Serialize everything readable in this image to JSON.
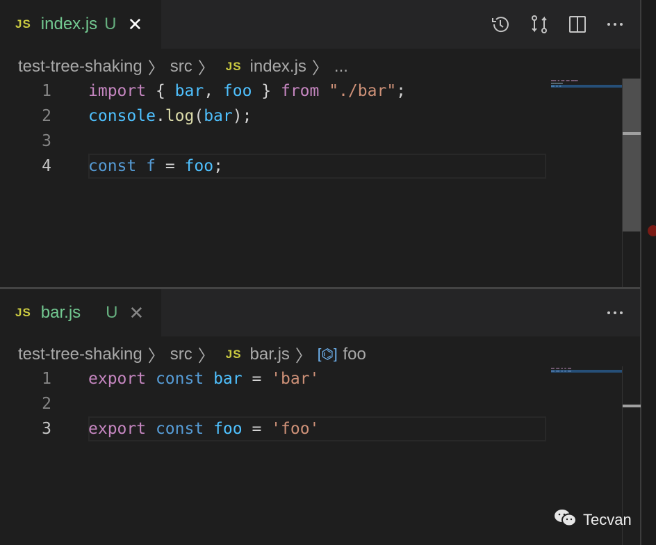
{
  "top_editor": {
    "tab": {
      "icon": "JS",
      "filename": "index.js",
      "status": "U"
    },
    "actions": [
      "timeline-icon",
      "compare-changes-icon",
      "split-editor-icon",
      "more-actions-icon"
    ],
    "breadcrumb": {
      "project": "test-tree-shaking",
      "folder": "src",
      "icon": "JS",
      "file": "index.js",
      "symbol": "..."
    },
    "lines": [
      {
        "n": "1"
      },
      {
        "n": "2"
      },
      {
        "n": "3"
      },
      {
        "n": "4"
      }
    ],
    "tokens": {
      "l1": [
        "import",
        " { ",
        "bar",
        ", ",
        "foo",
        " } ",
        "from",
        " ",
        "\"./bar\"",
        ";"
      ],
      "l2": [
        "console",
        ".",
        "log",
        "(",
        "bar",
        ");"
      ],
      "l4": [
        "const",
        " ",
        "f",
        " = ",
        "foo",
        ";"
      ]
    }
  },
  "bottom_editor": {
    "tab": {
      "icon": "JS",
      "filename": "bar.js",
      "status": "U"
    },
    "breadcrumb": {
      "project": "test-tree-shaking",
      "folder": "src",
      "icon": "JS",
      "file": "bar.js",
      "symbol": "foo"
    },
    "lines": [
      {
        "n": "1"
      },
      {
        "n": "2"
      },
      {
        "n": "3"
      }
    ],
    "tokens": {
      "l1": [
        "export",
        " ",
        "const",
        " ",
        "bar",
        " = ",
        "'bar'"
      ],
      "l3": [
        "export",
        " ",
        "const",
        " ",
        "foo",
        " = ",
        "'foo'"
      ]
    }
  },
  "watermark": "Tecvan"
}
